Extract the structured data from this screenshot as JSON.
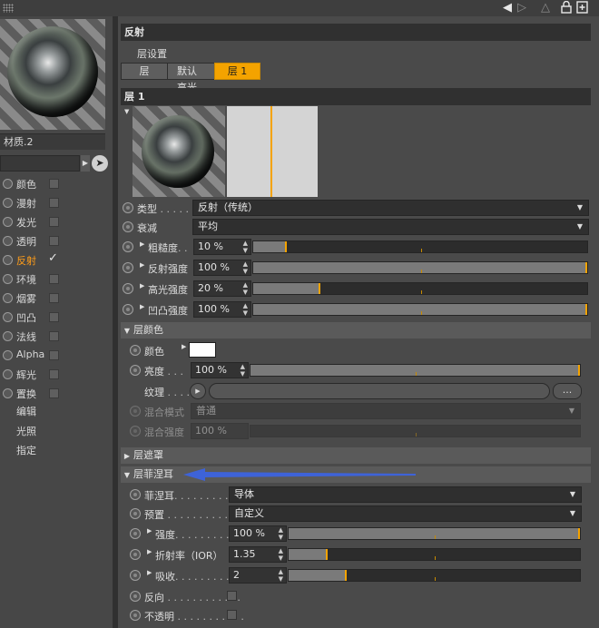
{
  "colors": {
    "accent": "#f4a300",
    "arrow": "#3e63d8",
    "active_channel": "#ff9d19"
  },
  "material_name": "材质.2",
  "channels": [
    {
      "label": "颜色",
      "checked": false
    },
    {
      "label": "漫射",
      "checked": false
    },
    {
      "label": "发光",
      "checked": false
    },
    {
      "label": "透明",
      "checked": false
    },
    {
      "label": "反射",
      "checked": true,
      "active": true
    },
    {
      "label": "环境",
      "checked": false
    },
    {
      "label": "烟雾",
      "checked": false
    },
    {
      "label": "凹凸",
      "checked": false
    },
    {
      "label": "法线",
      "checked": false
    },
    {
      "label": "Alpha",
      "checked": false
    },
    {
      "label": "辉光",
      "checked": false
    },
    {
      "label": "置换",
      "checked": false
    }
  ],
  "extra_items": [
    "编辑",
    "光照",
    "指定"
  ],
  "section_title": "反射",
  "layer_settings_label": "层设置",
  "tabs": [
    {
      "label": "层",
      "active": false
    },
    {
      "label": "默认高光",
      "active": false
    },
    {
      "label": "层 1",
      "active": true
    }
  ],
  "layer_title": "层 1",
  "params": {
    "type": {
      "label": "类型",
      "dots": ". . . . .",
      "value": "反射（传统）"
    },
    "atten": {
      "label": "衰减",
      "value": "平均"
    },
    "roughness": {
      "label": "粗糙度",
      "dots": ". .",
      "value": "10 %",
      "level": 0.1
    },
    "refl_strength": {
      "label": "反射强度",
      "value": "100 %",
      "level": 1.0
    },
    "spec_strength": {
      "label": "高光强度",
      "value": "20 %",
      "level": 0.2
    },
    "bump_strength": {
      "label": "凹凸强度",
      "value": "100 %",
      "level": 1.0
    }
  },
  "layer_color": {
    "header": "层颜色",
    "color_label": "颜色",
    "brightness_label": "亮度",
    "brightness_dots": ". . .",
    "brightness_value": "100 %",
    "brightness_level": 1.0,
    "texture_label": "纹理",
    "texture_dots": ". . . .",
    "texture_more": "...",
    "blend_mode_label": "混合模式",
    "blend_mode_value": "普通",
    "blend_strength_label": "混合强度",
    "blend_strength_value": "100 %"
  },
  "layer_mask_header": "层遮罩",
  "fresnel": {
    "header": "层菲涅耳",
    "fresnel_label": "菲涅耳",
    "fresnel_dots": ". . . . . . . . .",
    "fresnel_value": "导体",
    "preset_label": "预置",
    "preset_dots": ". . . . . . . . . . .",
    "preset_value": "自定义",
    "strength_label": "强度",
    "strength_dots": ". . . . . . . . .",
    "strength_value": "100 %",
    "strength_level": 1.0,
    "ior_label": "折射率（IOR）",
    "ior_value": "1.35",
    "ior_level": 0.135,
    "absorb_label": "吸收",
    "absorb_dots": ". . . . . . . . .",
    "absorb_value": "2",
    "absorb_level": 0.2,
    "invert_label": "反向",
    "invert_dots": ". . . . . . . . . . . .",
    "opaque_label": "不透明",
    "opaque_dots": ". . . . . . . . . . ."
  }
}
